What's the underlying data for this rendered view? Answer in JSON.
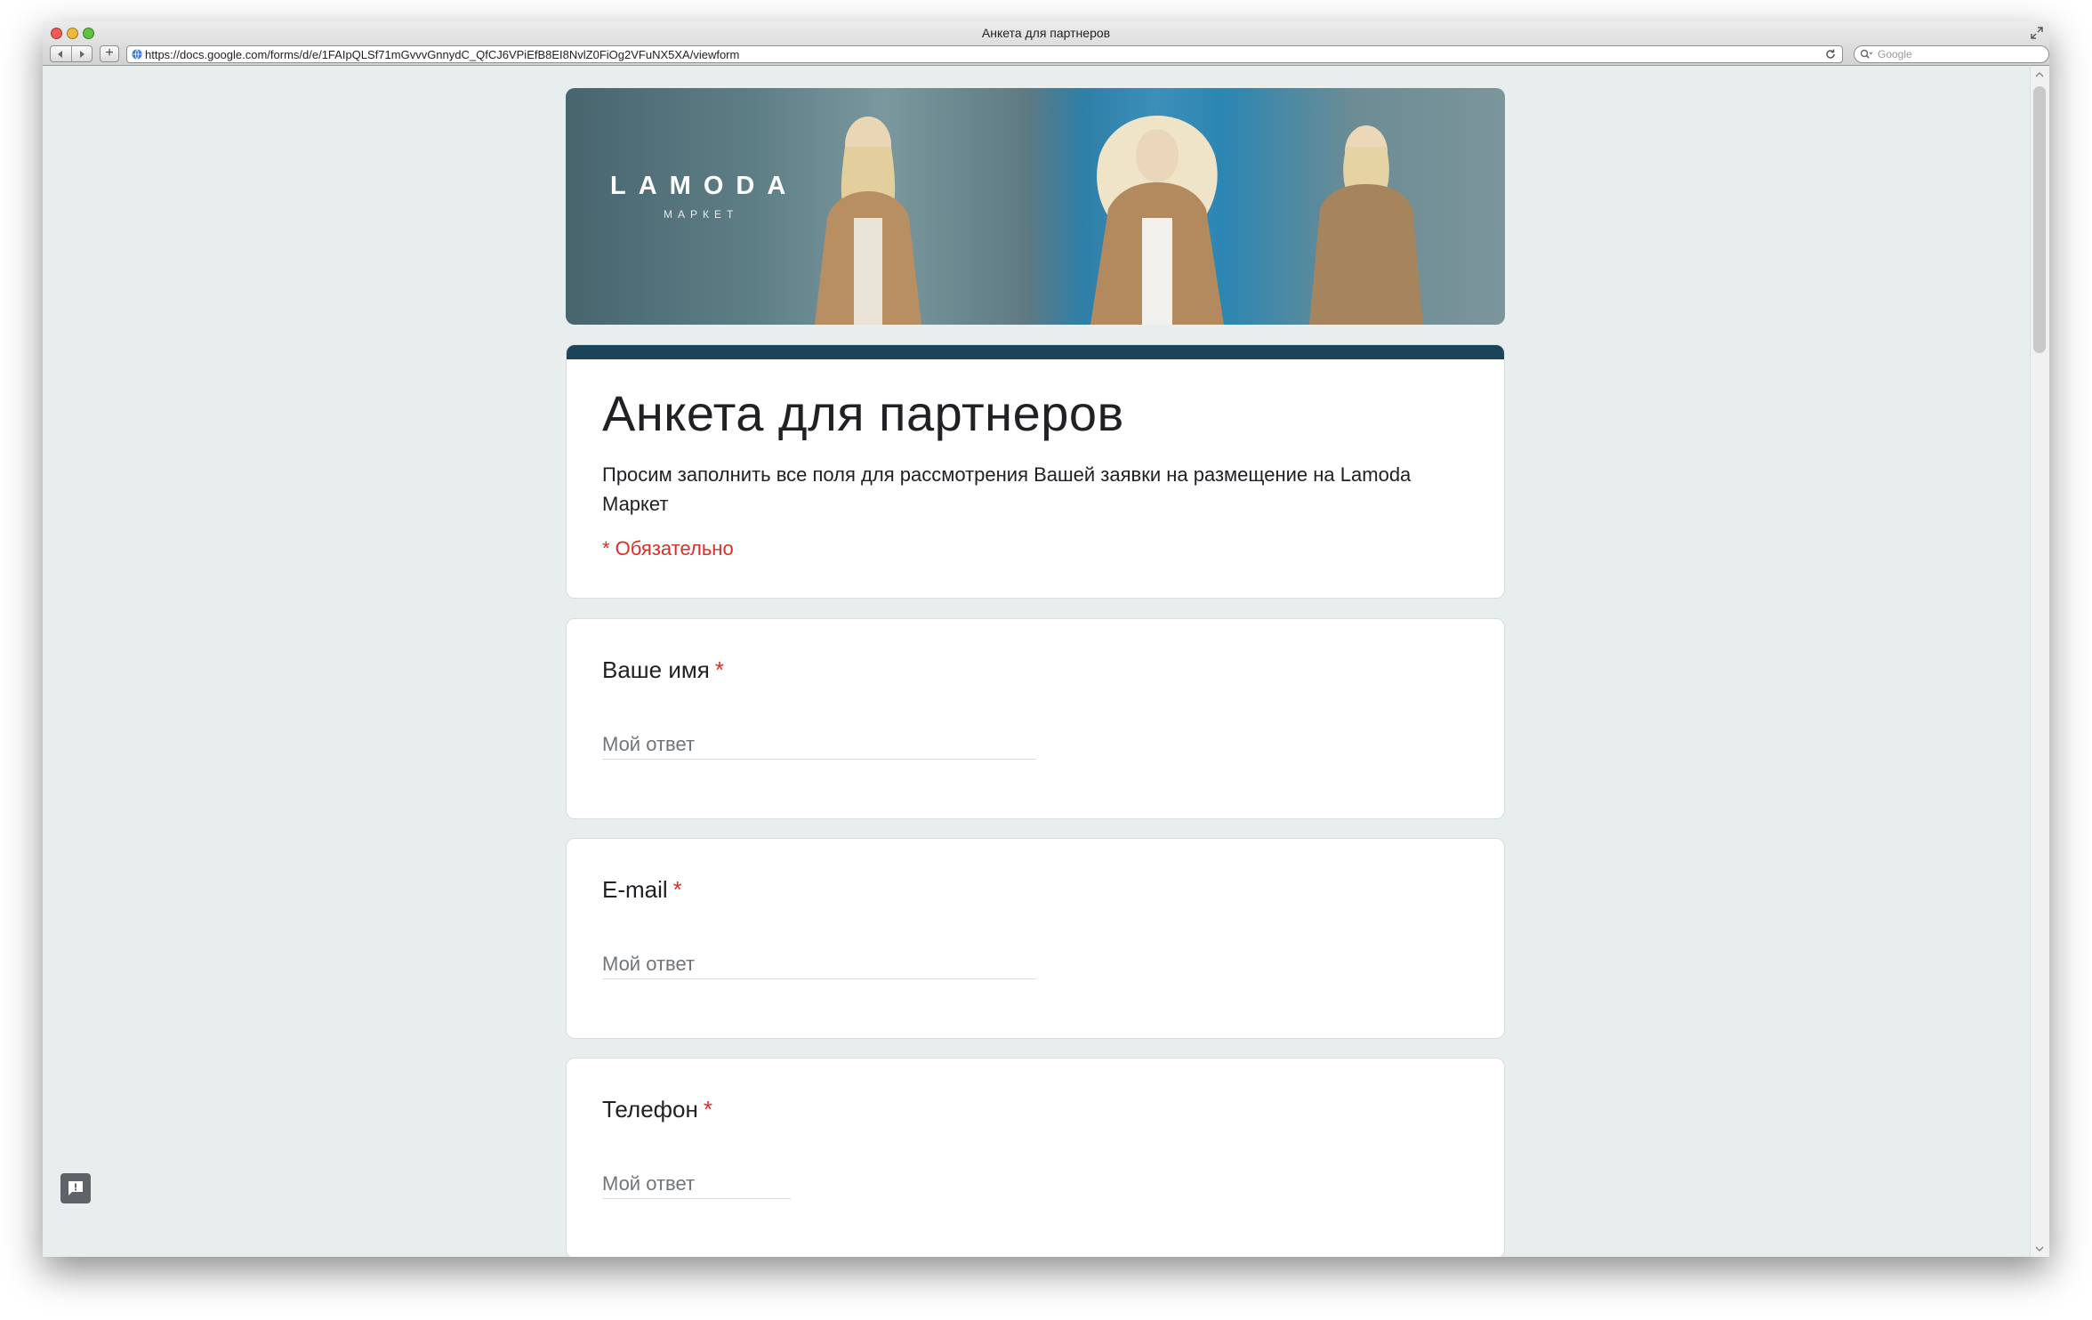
{
  "window": {
    "title": "Анкета для партнеров"
  },
  "toolbar": {
    "back_icon": "back-arrow-icon",
    "forward_icon": "forward-arrow-icon",
    "add_label": "+",
    "url": "https://docs.google.com/forms/d/e/1FAIpQLSf71mGvvvGnnydC_QfCJ6VPiEfB8EI8NvlZ0FiOg2VFuNX5XA/viewform",
    "search_placeholder": "Google"
  },
  "banner": {
    "logo_main": "LAMODA",
    "logo_sub": "МАРКЕТ"
  },
  "form": {
    "accent_color": "#1b4458",
    "title": "Анкета для партнеров",
    "description": "Просим заполнить все поля для рассмотрения Вашей заявки на размещение на Lamoda Маркет",
    "required_note": "* Обязательно",
    "questions": [
      {
        "label": "Ваше имя",
        "required_mark": "*",
        "placeholder": "Мой ответ"
      },
      {
        "label": "E-mail",
        "required_mark": "*",
        "placeholder": "Мой ответ"
      },
      {
        "label": "Телефон",
        "required_mark": "*",
        "placeholder": "Мой ответ"
      }
    ]
  },
  "feedback": {
    "icon": "report-feedback-icon"
  }
}
